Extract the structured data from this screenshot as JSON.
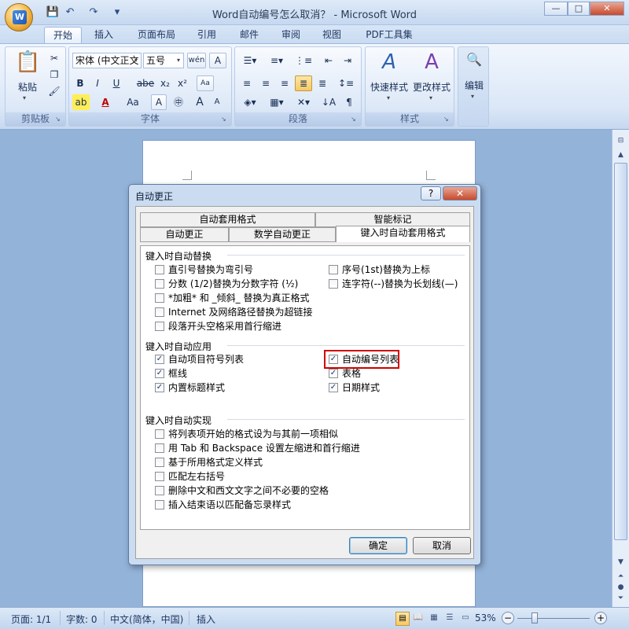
{
  "window": {
    "title": "Word自动编号怎么取消？ - Microsoft Word",
    "minimize": "—",
    "maximize": "□",
    "close": "✕"
  },
  "quick_access": {
    "save": "💾",
    "undo": "↶",
    "redo": "↷",
    "customize": "▾"
  },
  "ribbon_tabs": [
    "开始",
    "插入",
    "页面布局",
    "引用",
    "邮件",
    "审阅",
    "视图",
    "PDF工具集"
  ],
  "help": "?",
  "ribbon": {
    "clipboard": {
      "label": "剪贴板",
      "paste": "粘贴"
    },
    "font": {
      "label": "字体",
      "font_name": "宋体 (中文正文",
      "font_size": "五号",
      "bold": "B",
      "italic": "I",
      "underline": "U",
      "strike": "abe",
      "subscript": "x₂",
      "superscript": "x²",
      "change_case": "Aa",
      "grow": "A",
      "shrink": "A"
    },
    "paragraph": {
      "label": "段落"
    },
    "styles": {
      "label": "样式",
      "quick_styles": "快速样式",
      "change_styles": "更改样式"
    },
    "editing": {
      "label": "编辑"
    }
  },
  "dialog": {
    "title": "自动更正",
    "help_button": "?",
    "close_button": "✕",
    "tabs_row1": [
      "自动套用格式",
      "智能标记"
    ],
    "tabs_row2": [
      "自动更正",
      "数学自动更正",
      "键入时自动套用格式"
    ],
    "section1": {
      "title": "键入时自动替换",
      "left": [
        {
          "label": "直引号替换为弯引号",
          "checked": false
        },
        {
          "label": "分数 (1/2)替换为分数字符 (½)",
          "checked": false
        },
        {
          "label": "*加粗* 和 _倾斜_ 替换为真正格式",
          "checked": false
        },
        {
          "label": "Internet 及网络路径替换为超链接",
          "checked": false
        },
        {
          "label": "段落开头空格采用首行缩进",
          "checked": false
        }
      ],
      "right": [
        {
          "label": "序号(1st)替换为上标",
          "checked": false
        },
        {
          "label": "连字符(--)替换为长划线(—)",
          "checked": false
        }
      ]
    },
    "section2": {
      "title": "键入时自动应用",
      "left": [
        {
          "label": "自动项目符号列表",
          "checked": true
        },
        {
          "label": "框线",
          "checked": true
        },
        {
          "label": "内置标题样式",
          "checked": true
        }
      ],
      "right": [
        {
          "label": "自动编号列表",
          "checked": true
        },
        {
          "label": "表格",
          "checked": true
        },
        {
          "label": "日期样式",
          "checked": true
        }
      ]
    },
    "section3": {
      "title": "键入时自动实现",
      "items": [
        {
          "label": "将列表项开始的格式设为与其前一项相似",
          "checked": false
        },
        {
          "label": "用 Tab 和 Backspace 设置左缩进和首行缩进",
          "checked": false
        },
        {
          "label": "基于所用格式定义样式",
          "checked": false
        },
        {
          "label": "匹配左右括号",
          "checked": false
        },
        {
          "label": "删除中文和西文文字之间不必要的空格",
          "checked": false
        },
        {
          "label": "插入结束语以匹配备忘录样式",
          "checked": false
        }
      ]
    },
    "ok": "确定",
    "cancel": "取消",
    "check_mark": "✓"
  },
  "status": {
    "page": "页面: 1/1",
    "words": "字数: 0",
    "language": "中文(简体，中国)",
    "mode": "插入",
    "zoom": "53%",
    "zoom_out": "−",
    "zoom_in": "+"
  }
}
